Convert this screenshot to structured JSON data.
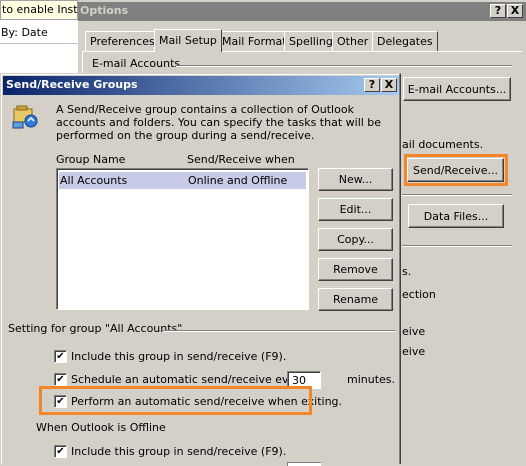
{
  "background_app": {
    "info_bar_text": "to enable Insta",
    "arrange_text": "By: Date"
  },
  "options_dialog": {
    "title": "Options",
    "help_glyph": "?",
    "close_glyph": "X",
    "tabs": [
      {
        "label": "Preferences"
      },
      {
        "label": "Mail Setup"
      },
      {
        "label": "Mail Format"
      },
      {
        "label": "Spelling"
      },
      {
        "label": "Other"
      },
      {
        "label": "Delegates"
      }
    ],
    "email_accounts_group": "E-mail Accounts",
    "email_accounts_button": "E-mail Accounts...",
    "partial_documents": "ail documents.",
    "send_receive_button": "Send/Receive...",
    "data_files_button": "Data Files...",
    "partial_s": "s.",
    "partial_ection": "ection",
    "partial_eive1": "eive",
    "partial_eive2": "eive"
  },
  "sr_dialog": {
    "title": "Send/Receive Groups",
    "help_glyph": "?",
    "close_glyph": "X",
    "description": "A Send/Receive group contains a collection of Outlook accounts and folders. You can specify the tasks that will be performed on the group during a send/receive.",
    "col_group_name": "Group Name",
    "col_send_receive_when": "Send/Receive when",
    "rows": [
      {
        "name": "All Accounts",
        "when": "Online and Offline"
      }
    ],
    "buttons": {
      "new": "New...",
      "edit": "Edit...",
      "copy": "Copy...",
      "remove": "Remove",
      "rename": "Rename"
    },
    "setting_for_group": "Setting for group \"All Accounts\"",
    "include_online": "Include this group in send/receive (F9).",
    "schedule": "Schedule an automatic send/receive every",
    "schedule_minutes_value": "30",
    "minutes_label": "minutes.",
    "perform_on_exit": "Perform an automatic send/receive when exiting.",
    "when_offline": "When Outlook is Offline",
    "include_offline": "Include this group in send/receive (F9).",
    "check_glyph": "✔"
  },
  "colors": {
    "title_bar": "#0a246a",
    "title_inactive": "#808080",
    "highlight_orange": "#f4862a",
    "selection": "#c7cbe8"
  }
}
